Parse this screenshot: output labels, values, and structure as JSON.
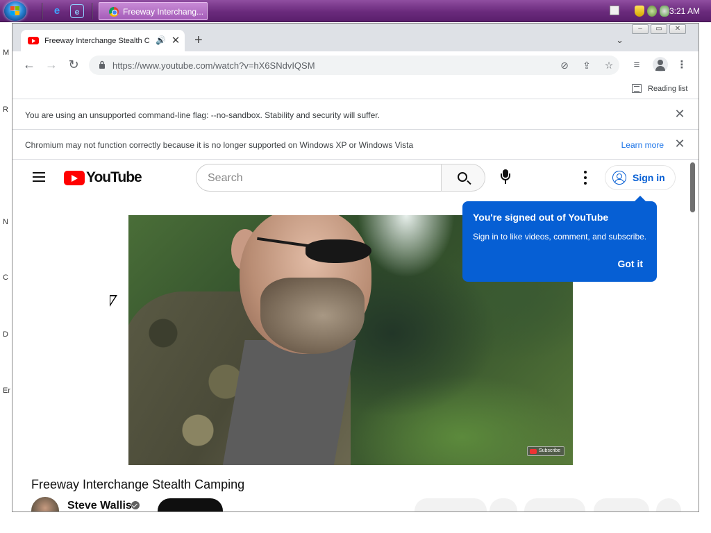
{
  "taskbar": {
    "task_label": "Freeway Interchang...",
    "clock": "3:21 AM"
  },
  "desktop": {
    "letters": [
      "M",
      "R",
      "N",
      "C",
      "D",
      "Er"
    ]
  },
  "browser": {
    "tab": {
      "title": "Freeway Interchange Stealth Ca",
      "close_glyph": "✕"
    },
    "new_tab_glyph": "+",
    "tab_search_glyph": "⌄",
    "window_controls": {
      "minimize": "–",
      "maximize": "▭",
      "close": "✕"
    },
    "address": {
      "url": "https://www.youtube.com/watch?v=hX6SNdvIQSM"
    },
    "bookmarks": {
      "reading_list": "Reading list"
    },
    "infobars": [
      {
        "message": "You are using an unsupported command-line flag: --no-sandbox. Stability and security will suffer.",
        "close_glyph": "✕"
      },
      {
        "message": "Chromium may not function correctly because it is no longer supported on Windows XP or Windows Vista",
        "link": "Learn more",
        "close_glyph": "✕"
      }
    ]
  },
  "youtube": {
    "logo_text": "YouTube",
    "search_placeholder": "Search",
    "sign_in": "Sign in",
    "tooltip": {
      "title": "You're signed out of YouTube",
      "body": "Sign in to like videos, comment, and subscribe.",
      "button": "Got it"
    },
    "video": {
      "title": "Freeway Interchange Stealth Camping",
      "watermark": "Subscribe"
    },
    "channel": {
      "name": "Steve Wallis"
    }
  },
  "colors": {
    "accent_blue": "#065fd4",
    "youtube_red": "#ff0000",
    "taskbar_purple": "#6a2a7c"
  },
  "icons": [
    "start-orb-icon",
    "ie-icon",
    "ie-alt-icon",
    "chrome-icon",
    "youtube-favicon",
    "speaker-icon",
    "back-icon",
    "forward-icon",
    "reload-icon",
    "lock-icon",
    "eye-off-icon",
    "share-icon",
    "star-icon",
    "media-queue-icon",
    "profile-icon",
    "menu-dots-icon",
    "reading-list-icon",
    "hamburger-icon",
    "search-icon",
    "mic-icon",
    "user-circle-icon",
    "verified-icon"
  ]
}
